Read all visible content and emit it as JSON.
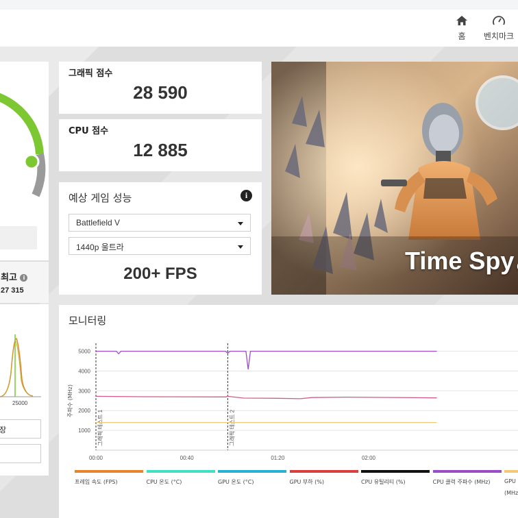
{
  "nav": {
    "home_label": "홈",
    "benchmark_label": "벤치마크"
  },
  "scores": {
    "graphics_label": "그래픽 점수",
    "graphics_value": "28 590",
    "cpu_label": "CPU 점수",
    "cpu_value": "12 885"
  },
  "left_panel": {
    "best_label": "최고",
    "best_value": "27 315",
    "dist_tick": "25000",
    "button1_label": "장"
  },
  "game_perf": {
    "title": "예상 게임 성능",
    "game_selected": "Battlefield V",
    "preset_selected": "1440p 울트라",
    "fps": "200+ FPS"
  },
  "hero": {
    "title": "Time Spy",
    "version_fragment": "(v"
  },
  "monitoring": {
    "title": "모니터링",
    "y_axis_label": "주파수 (MHz)",
    "y_ticks": [
      "5000",
      "4000",
      "3000",
      "2000",
      "1000"
    ],
    "x_ticks": [
      "00:00",
      "00:40",
      "01:20",
      "02:00"
    ],
    "marker1_label": "그래픽 테스트 1",
    "marker2_label": "그래픽 테스트 2",
    "legend": [
      {
        "label": "프레임 속도 (FPS)",
        "color": "#e8832a"
      },
      {
        "label": "CPU 온도 (°C)",
        "color": "#3fe0c8"
      },
      {
        "label": "GPU 온도 (°C)",
        "color": "#2ab0d8"
      },
      {
        "label": "GPU 부하 (%)",
        "color": "#d84040"
      },
      {
        "label": "CPU 유틸리티 (%)",
        "color": "#111111"
      },
      {
        "label": "CPU 클럭 주파수 (MHz)",
        "color": "#9a4cc8"
      },
      {
        "label": "GPU",
        "color": "#f0c878"
      }
    ],
    "legend_extra": "(MHz"
  },
  "colors": {
    "gauge_green": "#7dc832",
    "cpu_clock": "#9a4cc8",
    "gpu_clock": "#d05a8a",
    "gpu_mem": "#f0c878"
  }
}
